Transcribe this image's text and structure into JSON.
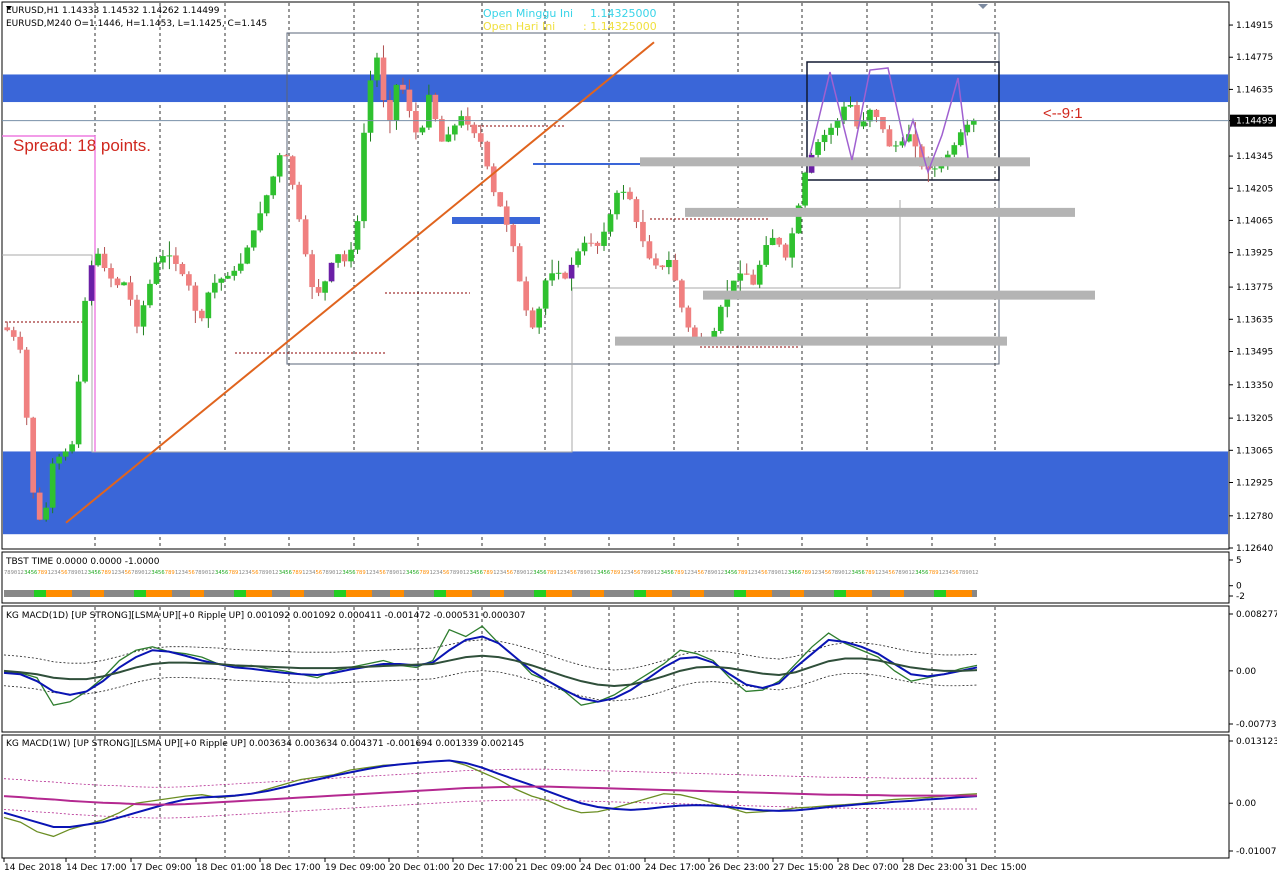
{
  "window": {
    "symbol_line1": "EURUSD,H1  1.14333 1.14532 1.14262 1.14499",
    "symbol_line2": "EURUSD,M240   O=1.1446,  H=1.1453,  L=1.1425,  C=1.145",
    "open_week_label": "Open Minggu Ini",
    "open_week_value": "1.14325000",
    "open_day_label": "Open Hari Ini",
    "open_day_value": ": 1.14325000",
    "spread_text": "Spread: 18 points.",
    "ratio_text": "<--9:1",
    "current_price": "1.14499"
  },
  "colors": {
    "zone_blue": "#3a66d8",
    "bull_candle": "#2fc12f",
    "bear_candle": "#f08080",
    "purple_candle": "#6b1fa6",
    "trend_line": "#e0641e",
    "sr_gray": "#b4b4b4",
    "spread_text": "#d0281e",
    "macd_blue": "#0a14b4",
    "macd_red": "#e01010",
    "macd_gray": "#2f4f3a",
    "macd_orange": "#f0a020",
    "macd_magenta": "#b42890",
    "tbst_green": "#22cc22",
    "tbst_orange": "#ff8c00",
    "tbst_gray": "#888888"
  },
  "chart_data": [
    {
      "type": "candlestick",
      "name": "EURUSD,H1",
      "ylim": [
        1.1264,
        1.1495
      ],
      "yticks": [
        "1.14915",
        "1.14775",
        "1.14635",
        "1.14499",
        "1.14345",
        "1.14205",
        "1.14065",
        "1.13925",
        "1.13775",
        "1.13635",
        "1.13495",
        "1.13350",
        "1.13205",
        "1.13065",
        "1.12925",
        "1.12780",
        "1.12640"
      ],
      "ytick_values": [
        1.14915,
        1.14775,
        1.14635,
        1.14499,
        1.14345,
        1.14205,
        1.14065,
        1.13925,
        1.13775,
        1.13635,
        1.13495,
        1.1335,
        1.13205,
        1.13065,
        1.12925,
        1.1278,
        1.1264
      ],
      "xticks": [
        "14 Dec 2018",
        "14 Dec 17:00",
        "17 Dec 09:00",
        "18 Dec 01:00",
        "18 Dec 17:00",
        "19 Dec 09:00",
        "20 Dec 01:00",
        "20 Dec 17:00",
        "21 Dec 09:00",
        "24 Dec 01:00",
        "24 Dec 17:00",
        "26 Dec 23:00",
        "27 Dec 15:00",
        "28 Dec 07:00",
        "28 Dec 23:00",
        "31 Dec 15:00"
      ],
      "current_price": 1.14499,
      "zones": [
        {
          "low": 1.1458,
          "high": 1.147
        },
        {
          "low": 1.127,
          "high": 1.1306
        }
      ],
      "path_points": [
        1.136,
        1.1358,
        1.1349,
        1.129,
        1.1271,
        1.1302,
        1.1305,
        1.131,
        1.137,
        1.1395,
        1.1385,
        1.1378,
        1.138,
        1.136,
        1.1375,
        1.139,
        1.1392,
        1.1386,
        1.1378,
        1.136,
        1.1378,
        1.1381,
        1.1383,
        1.1388,
        1.14,
        1.1412,
        1.1425,
        1.144,
        1.142,
        1.1395,
        1.1372,
        1.138,
        1.1393,
        1.1388,
        1.14,
        1.1462,
        1.1478,
        1.1445,
        1.147,
        1.1455,
        1.144,
        1.1463,
        1.144,
        1.1445,
        1.1452,
        1.1446,
        1.144,
        1.142,
        1.141,
        1.1395,
        1.137,
        1.1358,
        1.138,
        1.1385,
        1.1381,
        1.1392,
        1.1398,
        1.1395,
        1.1405,
        1.142,
        1.1418,
        1.1402,
        1.139,
        1.1385,
        1.139,
        1.137,
        1.1356,
        1.1353,
        1.1355,
        1.1372,
        1.138,
        1.1385,
        1.1378,
        1.1395,
        1.14,
        1.139,
        1.1407,
        1.143,
        1.144,
        1.1445,
        1.145,
        1.146,
        1.1445,
        1.1455,
        1.145,
        1.1438,
        1.144,
        1.1445,
        1.143,
        1.1428,
        1.1432,
        1.1438,
        1.1447,
        1.145
      ],
      "trend_line": {
        "from": 1.1275,
        "to": 1.1484
      },
      "sr_levels": [
        1.1432,
        1.141,
        1.1374,
        1.1354
      ]
    },
    {
      "type": "histogram",
      "name": "TBST TIME",
      "title": "TBST TIME 0.0000 0.0000 -1.0000",
      "ylim": [
        -2,
        5
      ],
      "yticks": [
        "5",
        "0",
        "-2"
      ],
      "ytick_values": [
        5,
        0,
        -2
      ]
    },
    {
      "type": "line",
      "name": "KG MACD(1D)",
      "title": "KG MACD(1D) [UP STRONG][LSMA UP][+0 Ripple UP] 0.001092 0.001092 0.000411 -0.001472 -0.000531 0.000307",
      "ylim": [
        -0.007738,
        0.008277
      ],
      "yticks": [
        "0.008277",
        "0.00",
        "-0.007738"
      ],
      "ytick_values": [
        0.008277,
        0,
        -0.007738
      ],
      "series": [
        {
          "values": [
            -0.0002,
            -0.0003,
            -0.001,
            -0.005,
            -0.0045,
            -0.003,
            -0.001,
            0.0015,
            0.003,
            0.0035,
            0.0028,
            0.0025,
            0.002,
            0.001,
            0.0005,
            0.0008,
            0.0003,
            0.0,
            -0.0005,
            -0.001,
            0.0,
            0.0005,
            0.001,
            0.0015,
            0.0008,
            0.0005,
            0.0015,
            0.006,
            0.005,
            0.0065,
            0.004,
            0.002,
            -0.0005,
            -0.0015,
            -0.003,
            -0.005,
            -0.0045,
            -0.0035,
            -0.002,
            -0.0005,
            0.001,
            0.003,
            0.0025,
            0.0015,
            -0.001,
            -0.003,
            -0.0028,
            -0.0015,
            0.001,
            0.0035,
            0.0055,
            0.004,
            0.003,
            0.002,
            0.0,
            -0.0015,
            -0.001,
            -0.0005,
            0.0003,
            0.0008
          ]
        },
        {
          "values": [
            -0.0003,
            -0.0005,
            -0.0015,
            -0.003,
            -0.0035,
            -0.003,
            -0.0015,
            0.0005,
            0.002,
            0.003,
            0.0028,
            0.0022,
            0.0015,
            0.001,
            0.0005,
            0.0003,
            0.0,
            -0.0003,
            -0.0005,
            -0.0006,
            -0.0003,
            0.0002,
            0.0006,
            0.001,
            0.001,
            0.0008,
            0.0012,
            0.003,
            0.0045,
            0.005,
            0.004,
            0.002,
            0.0,
            -0.0015,
            -0.0028,
            -0.004,
            -0.0045,
            -0.004,
            -0.0028,
            -0.0012,
            0.0005,
            0.0018,
            0.002,
            0.0012,
            -0.0005,
            -0.002,
            -0.0025,
            -0.0018,
            0.0005,
            0.0025,
            0.0045,
            0.0042,
            0.0035,
            0.0025,
            0.001,
            -0.0005,
            -0.0008,
            -0.0005,
            0.0,
            0.0005
          ]
        },
        {
          "values": [
            0.0,
            -0.0002,
            -0.0005,
            -0.001,
            -0.0012,
            -0.0012,
            -0.0008,
            -0.0002,
            0.0005,
            0.001,
            0.0012,
            0.0012,
            0.0011,
            0.001,
            0.0008,
            0.0007,
            0.0006,
            0.0005,
            0.0004,
            0.0004,
            0.0004,
            0.0005,
            0.0006,
            0.0007,
            0.0008,
            0.0009,
            0.001,
            0.0015,
            0.002,
            0.0022,
            0.002,
            0.0015,
            0.0008,
            0.0,
            -0.0008,
            -0.0015,
            -0.002,
            -0.0022,
            -0.002,
            -0.0015,
            -0.0008,
            0.0,
            0.0005,
            0.0006,
            0.0004,
            0.0,
            -0.0004,
            -0.0006,
            -0.0002,
            0.0006,
            0.0014,
            0.0018,
            0.0018,
            0.0015,
            0.001,
            0.0005,
            0.0002,
            0.0,
            0.0,
            0.0001
          ]
        }
      ]
    },
    {
      "type": "line",
      "name": "KG MACD(1W)",
      "title": "KG MACD(1W) [UP STRONG][LSMA UP][+0 Ripple UP] 0.003634 0.003634 0.004371 -0.001694 0.001339 0.002145",
      "ylim": [
        -0.010072,
        0.013123
      ],
      "yticks": [
        "0.013123",
        "0.00",
        "-0.010072"
      ],
      "ytick_values": [
        0.013123,
        0,
        -0.010072
      ],
      "series": [
        {
          "values": [
            -0.003,
            -0.004,
            -0.006,
            -0.007,
            -0.0055,
            -0.0045,
            -0.0035,
            -0.002,
            0.0,
            0.0005,
            0.001,
            0.0015,
            0.0018,
            0.0012,
            0.0015,
            0.002,
            0.003,
            0.004,
            0.005,
            0.0055,
            0.006,
            0.007,
            0.0075,
            0.008,
            0.0082,
            0.0085,
            0.0088,
            0.009,
            0.008,
            0.0065,
            0.005,
            0.003,
            0.0015,
            0.0005,
            -0.001,
            -0.002,
            -0.0018,
            -0.001,
            0.0,
            0.001,
            0.002,
            0.0018,
            0.001,
            0.0,
            -0.001,
            -0.002,
            -0.0018,
            -0.0015,
            -0.001,
            -0.0008,
            -0.0005,
            -0.0003,
            0.0,
            0.0005,
            0.0008,
            0.001,
            0.0012,
            0.0015,
            0.0018,
            0.002
          ]
        },
        {
          "values": [
            -0.002,
            -0.003,
            -0.004,
            -0.005,
            -0.005,
            -0.0045,
            -0.004,
            -0.003,
            -0.002,
            -0.001,
            0.0,
            0.0008,
            0.0012,
            0.0014,
            0.0016,
            0.002,
            0.0026,
            0.0034,
            0.0042,
            0.005,
            0.0058,
            0.0065,
            0.0072,
            0.0078,
            0.0082,
            0.0085,
            0.0088,
            0.009,
            0.0085,
            0.0075,
            0.0062,
            0.005,
            0.0038,
            0.0025,
            0.0012,
            0.0,
            -0.0008,
            -0.0012,
            -0.0014,
            -0.0012,
            -0.0008,
            -0.0005,
            -0.0004,
            -0.0005,
            -0.0008,
            -0.0012,
            -0.0015,
            -0.0016,
            -0.0015,
            -0.0012,
            -0.0008,
            -0.0005,
            -0.0002,
            0.0,
            0.0003,
            0.0005,
            0.0008,
            0.001,
            0.0013,
            0.0015
          ]
        },
        {
          "values": [
            0.0015,
            0.0013,
            0.001,
            0.0008,
            0.0005,
            0.0003,
            0.0001,
            0.0,
            -0.0002,
            -0.0003,
            -0.0003,
            -0.0002,
            0.0,
            0.0002,
            0.0004,
            0.0006,
            0.0008,
            0.001,
            0.0012,
            0.0014,
            0.0016,
            0.0018,
            0.002,
            0.0022,
            0.0024,
            0.0026,
            0.0028,
            0.003,
            0.0032,
            0.0033,
            0.0034,
            0.0035,
            0.0035,
            0.0035,
            0.0034,
            0.0033,
            0.0032,
            0.0031,
            0.003,
            0.0029,
            0.0028,
            0.0027,
            0.0026,
            0.0025,
            0.0024,
            0.0023,
            0.0022,
            0.0021,
            0.002,
            0.0019,
            0.0018,
            0.0018,
            0.0017,
            0.0017,
            0.0016,
            0.0016,
            0.0016,
            0.0016,
            0.0016,
            0.0016
          ]
        }
      ]
    }
  ]
}
